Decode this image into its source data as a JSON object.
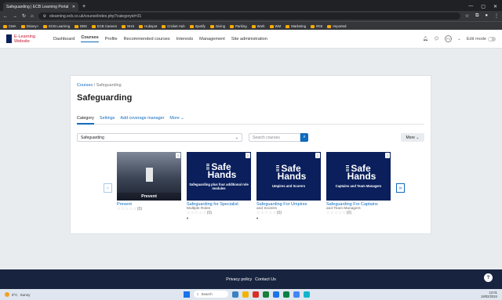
{
  "browser": {
    "tab_title": "Safeguarding | ECB Learning Portal",
    "url": "elearning.ecb.co.uk/course/index.php?categoryid=31",
    "bookmarks": [
      "CMA",
      "Disney+",
      "ECB Learning",
      "DBS",
      "ECB Careers",
      "NHS",
      "Hubspot",
      "Cricket Hub",
      "Spotify",
      "Giving",
      "Parking",
      "Work",
      "WM",
      "Marketing",
      "IRIS",
      "Imported"
    ]
  },
  "site": {
    "logo_line1": "E-Learning",
    "logo_line2": "Website",
    "nav": [
      "Dashboard",
      "Courses",
      "Profile",
      "Recommended courses",
      "Interests",
      "Management",
      "Site administration"
    ],
    "avatar_initials": "PJ",
    "edit_mode_label": "Edit mode"
  },
  "page": {
    "breadcrumb_root": "Courses",
    "breadcrumb_sep": "/",
    "breadcrumb_current": "Safeguarding",
    "title": "Safeguarding",
    "tabs": [
      "Category",
      "Settings",
      "Add coverage manager",
      "More"
    ],
    "category_select": "Safeguarding",
    "search_placeholder": "Search courses",
    "more_button": "More"
  },
  "courses": [
    {
      "thumb_caption": "Prevent",
      "title": "Prevent",
      "subtitle": "",
      "rating": "☆☆☆☆☆",
      "count": "(0)",
      "has_audio": false
    },
    {
      "thumb_caption": "Safeguarding plus four additional role modules",
      "title": "Safeguarding for Specialist",
      "subtitle": "Multiple Roles",
      "rating": "☆☆☆☆☆",
      "count": "(0)",
      "has_audio": true
    },
    {
      "thumb_caption": "Umpires and Scorers",
      "title": "Safeguarding For Umpires",
      "subtitle": "and Scorers",
      "rating": "☆☆☆☆☆",
      "count": "(0)",
      "has_audio": true
    },
    {
      "thumb_caption": "Captains and Team Managers",
      "title": "Safeguarding For Captains",
      "subtitle": "and Team Managers",
      "rating": "☆☆☆☆☆",
      "count": "(0)",
      "has_audio": false
    }
  ],
  "brand": {
    "safe": "Safe",
    "hands": "Hands"
  },
  "footer": {
    "privacy": "Privacy policy",
    "contact": "Contact Us"
  },
  "taskbar": {
    "temp": "9°C",
    "weather": "Sunny",
    "search": "Search",
    "time": "12:01",
    "date": "19/02/2024"
  },
  "colors": {
    "navy": "#0a1f5c",
    "link": "#0f6cbf",
    "footer": "#18233f"
  }
}
